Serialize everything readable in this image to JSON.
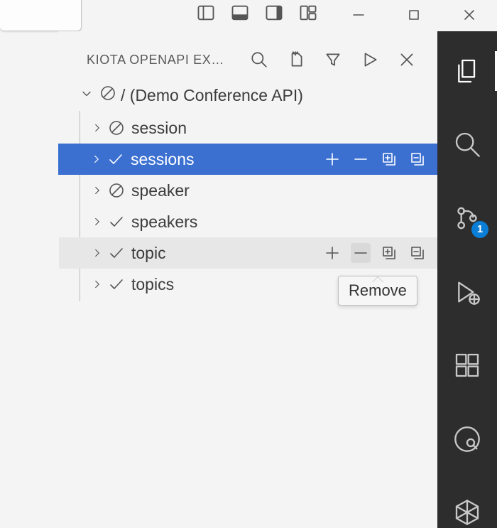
{
  "panel": {
    "title": "KIOTA OPENAPI EX…"
  },
  "tree": {
    "root": {
      "label": "/ (Demo Conference API)"
    },
    "items": [
      {
        "label": "session",
        "icon": "circle-slash",
        "selected": false,
        "hover": false,
        "actions": false
      },
      {
        "label": "sessions",
        "icon": "check",
        "selected": true,
        "hover": false,
        "actions": true
      },
      {
        "label": "speaker",
        "icon": "circle-slash",
        "selected": false,
        "hover": false,
        "actions": false
      },
      {
        "label": "speakers",
        "icon": "check",
        "selected": false,
        "hover": false,
        "actions": false
      },
      {
        "label": "topic",
        "icon": "check",
        "selected": false,
        "hover": true,
        "actions": true
      },
      {
        "label": "topics",
        "icon": "check",
        "selected": false,
        "hover": false,
        "actions": false
      }
    ]
  },
  "tooltip": {
    "text": "Remove"
  },
  "activity_bar": {
    "source_control_badge": "1"
  }
}
